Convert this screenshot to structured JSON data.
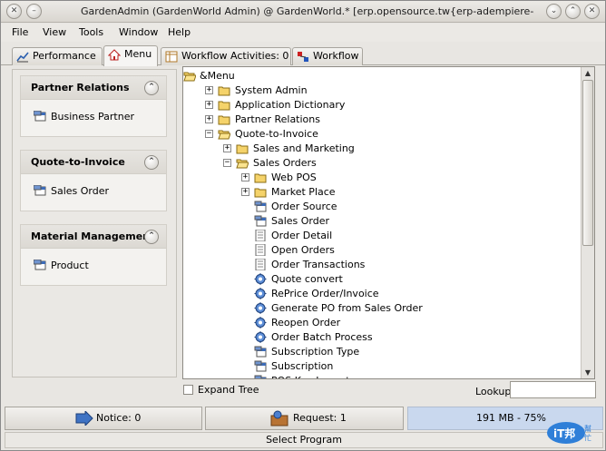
{
  "window": {
    "title": "GardenAdmin (GardenWorld Admin) @ GardenWorld.* [erp.opensource.tw{erp-adempiere-adempiere}]",
    "controls": [
      "close-icon",
      "minimize-icon",
      "maximize-icon"
    ]
  },
  "menubar": {
    "items": [
      "File",
      "View",
      "Tools",
      "Window",
      "Help"
    ]
  },
  "tabs": [
    {
      "label": "Performance",
      "icon": "chart-icon"
    },
    {
      "label": "Menu",
      "icon": "home-icon",
      "active": true
    },
    {
      "label": "Workflow Activities: 0",
      "icon": "table-icon"
    },
    {
      "label": "Workflow",
      "icon": "workflow-icon"
    }
  ],
  "groups": [
    {
      "title": "Partner Relations",
      "item": "Business Partner"
    },
    {
      "title": "Quote-to-Invoice",
      "item": "Sales Order"
    },
    {
      "title": "Material Management",
      "item": "Product"
    }
  ],
  "tree": [
    {
      "label": "&Menu",
      "icon": "folder-open",
      "expander": ""
    },
    {
      "label": "System Admin",
      "icon": "folder",
      "expander": "+"
    },
    {
      "label": "Application Dictionary",
      "icon": "folder",
      "expander": "+"
    },
    {
      "label": "Partner Relations",
      "icon": "folder",
      "expander": "+"
    },
    {
      "label": "Quote-to-Invoice",
      "icon": "folder-open",
      "expander": "−"
    },
    {
      "label": "Sales and Marketing",
      "icon": "folder",
      "expander": "+"
    },
    {
      "label": "Sales Orders",
      "icon": "folder-open",
      "expander": "−"
    },
    {
      "label": "Web POS",
      "icon": "folder",
      "expander": "+"
    },
    {
      "label": "Market Place",
      "icon": "folder",
      "expander": "+"
    },
    {
      "label": "Order Source",
      "icon": "window",
      "expander": ""
    },
    {
      "label": "Sales Order",
      "icon": "window",
      "expander": ""
    },
    {
      "label": "Order Detail",
      "icon": "report",
      "expander": ""
    },
    {
      "label": "Open Orders",
      "icon": "report",
      "expander": ""
    },
    {
      "label": "Order Transactions",
      "icon": "report",
      "expander": ""
    },
    {
      "label": "Quote convert",
      "icon": "process",
      "expander": ""
    },
    {
      "label": "RePrice Order/Invoice",
      "icon": "process",
      "expander": ""
    },
    {
      "label": "Generate PO from Sales Order",
      "icon": "process",
      "expander": ""
    },
    {
      "label": "Reopen Order",
      "icon": "process",
      "expander": ""
    },
    {
      "label": "Order Batch Process",
      "icon": "process",
      "expander": ""
    },
    {
      "label": "Subscription Type",
      "icon": "window",
      "expander": ""
    },
    {
      "label": "Subscription",
      "icon": "window",
      "expander": ""
    },
    {
      "label": "POS Key Layout",
      "icon": "window",
      "expander": ""
    }
  ],
  "bottom": {
    "expand_tree_label": "Expand Tree",
    "expand_tree_checked": false,
    "lookup_label": "Lookup",
    "lookup_value": ""
  },
  "status": {
    "notice": "Notice: 0",
    "request": "Request: 1",
    "memory": "191 MB - 75%",
    "select_program": "Select Program"
  },
  "brand": {
    "text": "iT邦幫忙"
  }
}
